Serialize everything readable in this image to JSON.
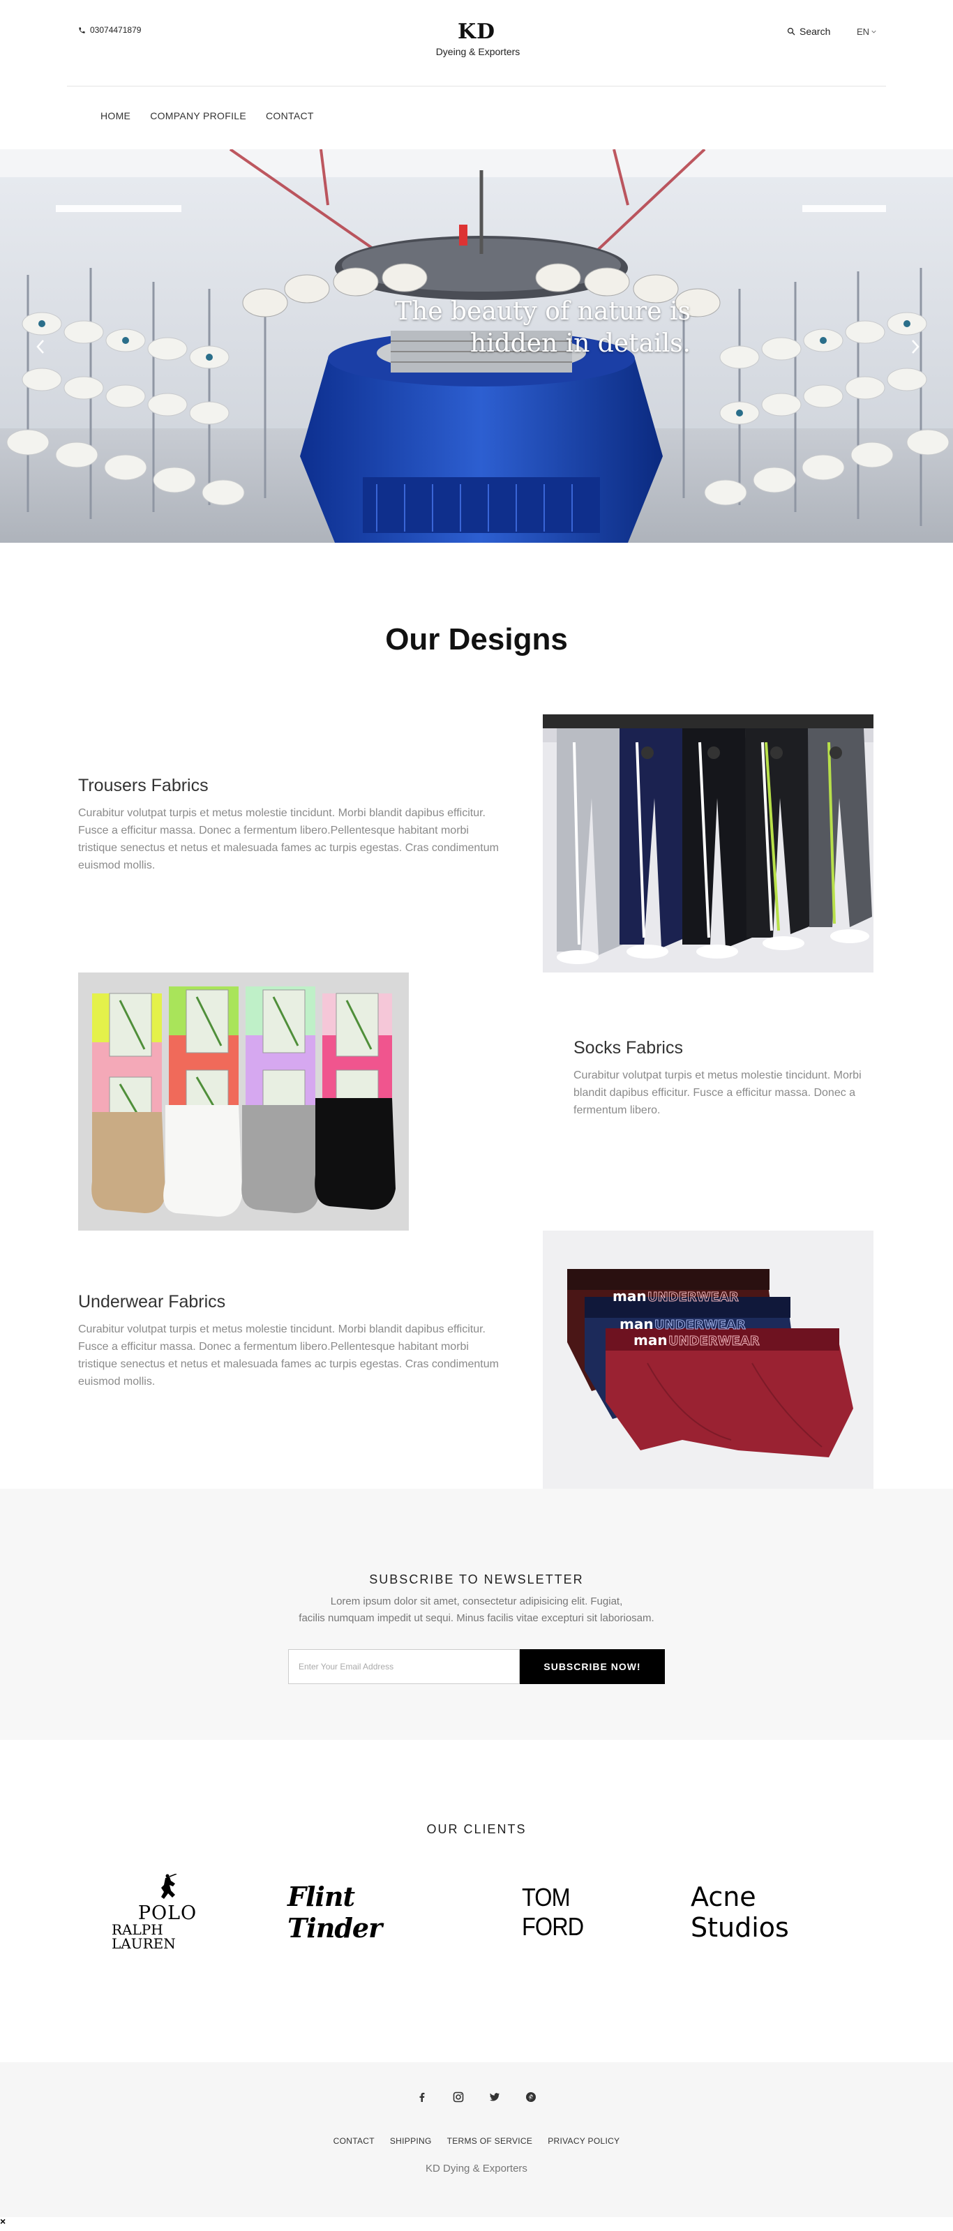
{
  "header": {
    "phone": "03074471879",
    "logo": "KD",
    "logo_subtitle": "Dyeing & Exporters",
    "search_label": "Search",
    "language": "EN"
  },
  "nav": {
    "items": [
      "HOME",
      "COMPANY PROFILE",
      "CONTACT"
    ]
  },
  "hero": {
    "caption_line1": "The beauty of nature is",
    "caption_line2": "hidden in details."
  },
  "designs": {
    "title": "Our Designs",
    "items": [
      {
        "title": "Trousers Fabrics",
        "text": "Curabitur volutpat turpis et metus molestie tincidunt. Morbi blandit dapibus efficitur. Fusce a efficitur massa. Donec a fermentum libero.Pellentesque habitant morbi tristique senectus et netus et malesuada fames ac turpis egestas. Cras condimentum euismod mollis."
      },
      {
        "title": "Socks Fabrics",
        "text": "Curabitur volutpat turpis et metus molestie tincidunt. Morbi blandit dapibus efficitur. Fusce a efficitur massa. Donec a fermentum libero."
      },
      {
        "title": "Underwear Fabrics",
        "text": "Curabitur volutpat turpis et metus molestie tincidunt. Morbi blandit dapibus efficitur. Fusce a efficitur massa. Donec a fermentum libero.Pellentesque habitant morbi tristique senectus et netus et malesuada fames ac turpis egestas. Cras condimentum euismod mollis."
      }
    ],
    "underwear_brand": "man",
    "underwear_band_text": "UNDERWEAR"
  },
  "newsletter": {
    "title": "SUBSCRIBE TO NEWSLETTER",
    "desc_line1": "Lorem ipsum dolor sit amet, consectetur adipisicing elit. Fugiat,",
    "desc_line2": "facilis numquam impedit ut sequi. Minus facilis vitae excepturi sit laboriosam.",
    "placeholder": "Enter Your Email Address",
    "button": "SUBSCRIBE NOW!"
  },
  "clients": {
    "title": "OUR CLIENTS",
    "polo_line1": "POLO",
    "polo_line2": "RALPH LAUREN",
    "flint": "Flint Tinder",
    "tomford": "TOM FORD",
    "acne": "Acne Studios"
  },
  "footer": {
    "social_icons": [
      "facebook-icon",
      "instagram-icon",
      "twitter-icon",
      "pinterest-icon"
    ],
    "links": [
      "CONTACT",
      "SHIPPING",
      "TERMS OF SERVICE",
      "PRIVACY POLICY"
    ],
    "copyright": "KD Dying & Exporters",
    "close_glyph": "×"
  }
}
